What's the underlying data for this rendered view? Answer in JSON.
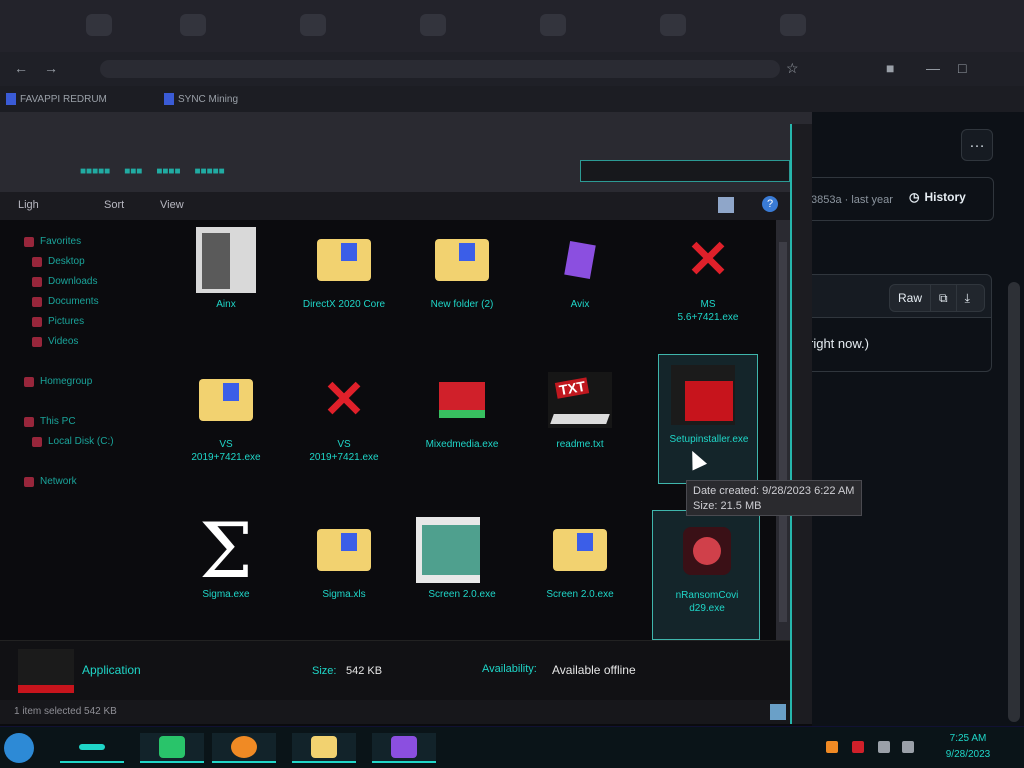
{
  "browser": {
    "bookmarks": [
      {
        "label": "FAVAPPI REDRUM"
      },
      {
        "label": "SYNC Mining"
      }
    ]
  },
  "webpage": {
    "more_label": "…",
    "commit_meta": "3853a · last year",
    "history_label": "History",
    "raw_label": "Raw",
    "copy_icon": "copy-icon",
    "download_icon": "download-icon",
    "content_text": "right now.)"
  },
  "explorer": {
    "menu": [
      {
        "label": "Ligh"
      },
      {
        "label": "Sort"
      },
      {
        "label": "View"
      }
    ],
    "nav_items": [
      {
        "label": "Favorites"
      },
      {
        "label": "Desktop"
      },
      {
        "label": "Downloads"
      },
      {
        "label": "Documents"
      },
      {
        "label": "Pictures"
      },
      {
        "label": "Videos"
      },
      {
        "label": "Homegroup"
      },
      {
        "label": "This PC"
      },
      {
        "label": "Local Disk (C:)"
      },
      {
        "label": "Network"
      }
    ],
    "files": [
      {
        "label": "Ainx",
        "icon": "doc-icon"
      },
      {
        "label": "DirectX 2020 Core",
        "icon": "folder-icon"
      },
      {
        "label": "New folder (2)",
        "icon": "folder-icon"
      },
      {
        "label": "Avix",
        "icon": "gem-icon"
      },
      {
        "label": "MS\n5.6+7421.exe",
        "icon": "red-x-icon"
      },
      {
        "label": "VS\n2019+7421.exe",
        "icon": "folder-icon"
      },
      {
        "label": "VS\n2019+7421.exe",
        "icon": "red-x-icon"
      },
      {
        "label": "Mixedmedia.exe",
        "icon": "mixed-icon"
      },
      {
        "label": "readme.txt",
        "icon": "txt-icon"
      },
      {
        "label": "Setupinstaller.exe",
        "icon": "installer-icon"
      },
      {
        "label": "Sigma.exe",
        "icon": "sigma-icon"
      },
      {
        "label": "Sigma.xls",
        "icon": "folder-icon"
      },
      {
        "label": "Screen 2.0.exe",
        "icon": "panel-icon"
      },
      {
        "label": "Screen 2.0.exe",
        "icon": "folder-icon"
      },
      {
        "label": "nRansomCovi\nd29.exe",
        "icon": "virus-icon"
      }
    ],
    "details": {
      "type": "Application",
      "size_label": "Size:",
      "size_value": "542 KB",
      "availability_label": "Availability:",
      "availability_value": "Available offline"
    },
    "status_text": "1 item selected 542 KB"
  },
  "tooltip": {
    "date_created": "Date created: 9/28/2023 6:22 AM",
    "size": "Size: 21.5 MB"
  },
  "taskbar": {
    "clock_time": "7:25 AM",
    "clock_date": "9/28/2023"
  },
  "colors": {
    "accent": "#1fd6c8",
    "folder": "#f2d270",
    "danger": "#e0202a"
  }
}
